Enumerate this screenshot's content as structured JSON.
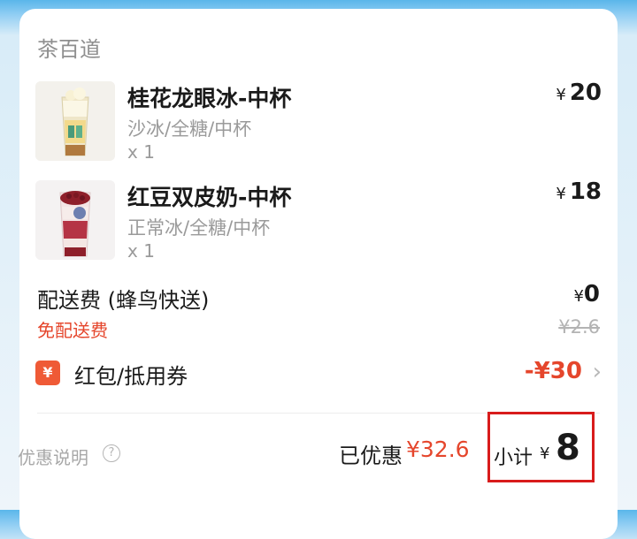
{
  "store": {
    "name": "茶百道"
  },
  "items": [
    {
      "name": "桂花龙眼冰-中杯",
      "spec": "沙冰/全糖/中杯",
      "qty": "x 1",
      "currency": "¥",
      "price": "20"
    },
    {
      "name": "红豆双皮奶-中杯",
      "spec": "正常冰/全糖/中杯",
      "qty": "x 1",
      "currency": "¥",
      "price": "18"
    }
  ],
  "delivery": {
    "label": "配送费 (蜂鸟快送)",
    "free_label": "免配送费",
    "currency": "¥",
    "value": "0",
    "original": "¥2.6"
  },
  "coupon": {
    "badge": "¥",
    "label": "红包/抵用券",
    "value": "-¥30",
    "chevron": "›"
  },
  "summary": {
    "discount_note": "优惠说明",
    "help": "?",
    "saved_label": "已优惠",
    "saved_value": "¥32.6",
    "subtotal_label": "小计",
    "subtotal_currency": "¥",
    "subtotal_value": "8"
  },
  "colors": {
    "accent_red": "#e5462c",
    "highlight_box": "#d81c1c"
  }
}
